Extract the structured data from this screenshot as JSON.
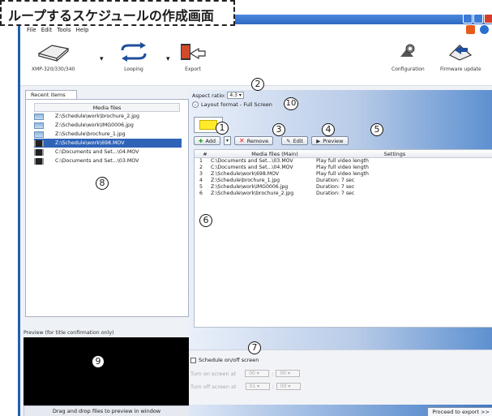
{
  "annotation_title": "ループするスケジュールの作成画面",
  "menu": [
    "File",
    "Edit",
    "Tools",
    "Help"
  ],
  "toolbar": {
    "device": "XMP-320/330/340",
    "looping": "Looping",
    "export": "Export",
    "configuration": "Configuration",
    "firmware": "Firmware update"
  },
  "left": {
    "tab": "Recent items",
    "media_header": "Media files",
    "items": [
      "Z:\\Schedule\\work\\brochure_2.jpg",
      "Z:\\Schedule\\work\\IMG0006.jpg",
      "Z:\\Schedule\\brochure_1.jpg",
      "Z:\\Schedule\\work\\698.MOV",
      "C:\\Documents and Set...\\04.MOV",
      "C:\\Documents and Set...\\03.MOV"
    ],
    "preview_label": "Preview (for title confirmation only)",
    "drag_hint": "Drag and drop files to preview in window"
  },
  "right": {
    "aspect_label": "Aspect ratio:",
    "aspect_value": "4:3",
    "layout_label": "Layout format - Full Screen",
    "buttons": {
      "add": "Add",
      "remove": "Remove",
      "edit": "Edit",
      "preview": "Preview"
    },
    "table_headers": [
      "#",
      "Media files (Main)",
      "Settings"
    ],
    "rows": [
      {
        "n": "1",
        "file": "C:\\Documents and Set...\\03.MOV",
        "setting": "Play full video length"
      },
      {
        "n": "2",
        "file": "C:\\Documents and Set...\\04.MOV",
        "setting": "Play full video length"
      },
      {
        "n": "3",
        "file": "Z:\\Schedule\\work\\698.MOV",
        "setting": "Play full video length"
      },
      {
        "n": "4",
        "file": "Z:\\Schedule\\brochure_1.jpg",
        "setting": "Duration: 7 sec"
      },
      {
        "n": "5",
        "file": "Z:\\Schedule\\work\\IMG0006.jpg",
        "setting": "Duration: 7 sec"
      },
      {
        "n": "6",
        "file": "Z:\\Schedule\\work\\brochure_2.jpg",
        "setting": "Duration: 7 sec"
      }
    ],
    "schedule_label": "Schedule on/off screen",
    "turn_on": "Turn on screen at",
    "turn_off": "Turn off screen at",
    "on_h": "00",
    "on_m": "00",
    "off_h": "01",
    "off_m": "00",
    "proceed": "Proceed to export >>"
  },
  "annotations": [
    "1",
    "2",
    "3",
    "4",
    "5",
    "6",
    "7",
    "8",
    "9",
    "10"
  ]
}
